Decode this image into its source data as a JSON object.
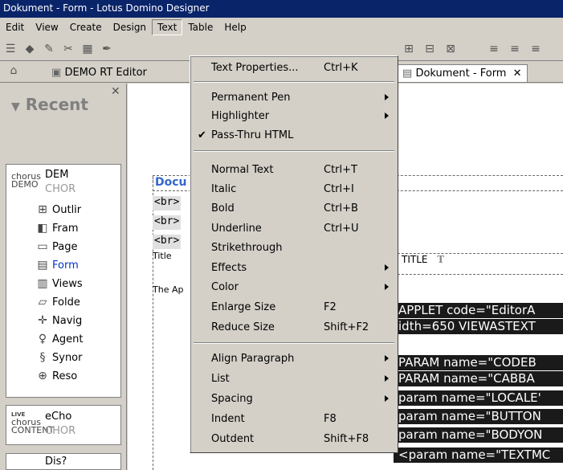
{
  "window": {
    "title": "Dokument - Form - Lotus Domino Designer"
  },
  "menubar": {
    "items": [
      {
        "label": "Edit",
        "open": false
      },
      {
        "label": "View",
        "open": false
      },
      {
        "label": "Create",
        "open": false
      },
      {
        "label": "Design",
        "open": false
      },
      {
        "label": "Text",
        "open": true
      },
      {
        "label": "Table",
        "open": false
      },
      {
        "label": "Help",
        "open": false
      }
    ]
  },
  "tabs": [
    {
      "label": "DEMO RT Editor",
      "active": false
    },
    {
      "label": "Dokument - Form",
      "active": true,
      "close": "✕"
    }
  ],
  "sidebar": {
    "recent_label": "Recent",
    "db1": {
      "logo_top": "chorus",
      "logo_bottom": "DEMO",
      "title": "DEM",
      "subtitle": "CHOR"
    },
    "items": [
      {
        "label": "Outlir",
        "icon": "outline-icon"
      },
      {
        "label": "Fram",
        "icon": "frameset-icon"
      },
      {
        "label": "Page",
        "icon": "page-icon"
      },
      {
        "label": "Form",
        "icon": "form-icon",
        "active": true
      },
      {
        "label": "Views",
        "icon": "views-icon"
      },
      {
        "label": "Folde",
        "icon": "folder-icon"
      },
      {
        "label": "Navig",
        "icon": "navigator-icon"
      },
      {
        "label": "Agent",
        "icon": "agent-icon"
      },
      {
        "label": "Synor",
        "icon": "synopsis-icon"
      },
      {
        "label": "Reso",
        "icon": "resources-icon"
      }
    ],
    "db2": {
      "logo_badge": "LIVE",
      "logo_top": "chorus",
      "logo_bottom": "CONTENT",
      "title": "eCho",
      "subtitle": "CHOR"
    },
    "db3": {
      "title": "Dis?"
    }
  },
  "editor": {
    "doc_heading": "Docu",
    "br_lines": [
      "<br>",
      "<br>",
      "<br>"
    ],
    "title_label": "Title",
    "title_field": "TITLE",
    "title_field_icon": "T",
    "applet_label": "The Ap",
    "code_lines": [
      "APPLET code=\"EditorA",
      "idth=650 VIEWASTEXT",
      "PARAM name=\"CODEB",
      "PARAM name=\"CABBA",
      "param name=\"LOCALE'",
      "param name=\"BUTTON",
      "param name=\"BODYON",
      "<param name=\"TEXTMC"
    ]
  },
  "text_menu": {
    "items": [
      {
        "label": "Text Properties...",
        "shortcut": "Ctrl+K"
      },
      {
        "label": "Permanent Pen",
        "submenu": true
      },
      {
        "label": "Highlighter",
        "submenu": true
      },
      {
        "label": "Pass-Thru HTML",
        "checked": true
      },
      {
        "label": "Normal Text",
        "shortcut": "Ctrl+T"
      },
      {
        "label": "Italic",
        "shortcut": "Ctrl+I"
      },
      {
        "label": "Bold",
        "shortcut": "Ctrl+B"
      },
      {
        "label": "Underline",
        "shortcut": "Ctrl+U"
      },
      {
        "label": "Strikethrough"
      },
      {
        "label": "Effects",
        "submenu": true
      },
      {
        "label": "Color",
        "submenu": true
      },
      {
        "label": "Enlarge Size",
        "shortcut": "F2"
      },
      {
        "label": "Reduce Size",
        "shortcut": "Shift+F2"
      },
      {
        "label": "Align Paragraph",
        "submenu": true
      },
      {
        "label": "List",
        "submenu": true
      },
      {
        "label": "Spacing",
        "submenu": true
      },
      {
        "label": "Indent",
        "shortcut": "F8"
      },
      {
        "label": "Outdent",
        "shortcut": "Shift+F8"
      }
    ]
  },
  "colors": {
    "title_bar": "#0a246a",
    "doc_heading": "#3366cc",
    "active_link": "#0033cc",
    "code_bg": "#1a1a1a"
  }
}
